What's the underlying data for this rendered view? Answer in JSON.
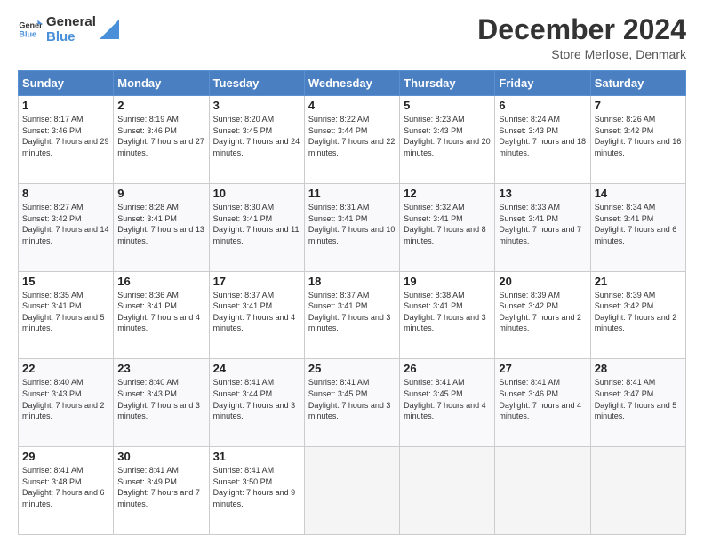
{
  "header": {
    "logo_general": "General",
    "logo_blue": "Blue",
    "month_title": "December 2024",
    "subtitle": "Store Merlose, Denmark"
  },
  "days_of_week": [
    "Sunday",
    "Monday",
    "Tuesday",
    "Wednesday",
    "Thursday",
    "Friday",
    "Saturday"
  ],
  "weeks": [
    [
      {
        "day": "1",
        "sunrise": "8:17 AM",
        "sunset": "3:46 PM",
        "daylight": "7 hours and 29 minutes."
      },
      {
        "day": "2",
        "sunrise": "8:19 AM",
        "sunset": "3:46 PM",
        "daylight": "7 hours and 27 minutes."
      },
      {
        "day": "3",
        "sunrise": "8:20 AM",
        "sunset": "3:45 PM",
        "daylight": "7 hours and 24 minutes."
      },
      {
        "day": "4",
        "sunrise": "8:22 AM",
        "sunset": "3:44 PM",
        "daylight": "7 hours and 22 minutes."
      },
      {
        "day": "5",
        "sunrise": "8:23 AM",
        "sunset": "3:43 PM",
        "daylight": "7 hours and 20 minutes."
      },
      {
        "day": "6",
        "sunrise": "8:24 AM",
        "sunset": "3:43 PM",
        "daylight": "7 hours and 18 minutes."
      },
      {
        "day": "7",
        "sunrise": "8:26 AM",
        "sunset": "3:42 PM",
        "daylight": "7 hours and 16 minutes."
      }
    ],
    [
      {
        "day": "8",
        "sunrise": "8:27 AM",
        "sunset": "3:42 PM",
        "daylight": "7 hours and 14 minutes."
      },
      {
        "day": "9",
        "sunrise": "8:28 AM",
        "sunset": "3:41 PM",
        "daylight": "7 hours and 13 minutes."
      },
      {
        "day": "10",
        "sunrise": "8:30 AM",
        "sunset": "3:41 PM",
        "daylight": "7 hours and 11 minutes."
      },
      {
        "day": "11",
        "sunrise": "8:31 AM",
        "sunset": "3:41 PM",
        "daylight": "7 hours and 10 minutes."
      },
      {
        "day": "12",
        "sunrise": "8:32 AM",
        "sunset": "3:41 PM",
        "daylight": "7 hours and 8 minutes."
      },
      {
        "day": "13",
        "sunrise": "8:33 AM",
        "sunset": "3:41 PM",
        "daylight": "7 hours and 7 minutes."
      },
      {
        "day": "14",
        "sunrise": "8:34 AM",
        "sunset": "3:41 PM",
        "daylight": "7 hours and 6 minutes."
      }
    ],
    [
      {
        "day": "15",
        "sunrise": "8:35 AM",
        "sunset": "3:41 PM",
        "daylight": "7 hours and 5 minutes."
      },
      {
        "day": "16",
        "sunrise": "8:36 AM",
        "sunset": "3:41 PM",
        "daylight": "7 hours and 4 minutes."
      },
      {
        "day": "17",
        "sunrise": "8:37 AM",
        "sunset": "3:41 PM",
        "daylight": "7 hours and 4 minutes."
      },
      {
        "day": "18",
        "sunrise": "8:37 AM",
        "sunset": "3:41 PM",
        "daylight": "7 hours and 3 minutes."
      },
      {
        "day": "19",
        "sunrise": "8:38 AM",
        "sunset": "3:41 PM",
        "daylight": "7 hours and 3 minutes."
      },
      {
        "day": "20",
        "sunrise": "8:39 AM",
        "sunset": "3:42 PM",
        "daylight": "7 hours and 2 minutes."
      },
      {
        "day": "21",
        "sunrise": "8:39 AM",
        "sunset": "3:42 PM",
        "daylight": "7 hours and 2 minutes."
      }
    ],
    [
      {
        "day": "22",
        "sunrise": "8:40 AM",
        "sunset": "3:43 PM",
        "daylight": "7 hours and 2 minutes."
      },
      {
        "day": "23",
        "sunrise": "8:40 AM",
        "sunset": "3:43 PM",
        "daylight": "7 hours and 3 minutes."
      },
      {
        "day": "24",
        "sunrise": "8:41 AM",
        "sunset": "3:44 PM",
        "daylight": "7 hours and 3 minutes."
      },
      {
        "day": "25",
        "sunrise": "8:41 AM",
        "sunset": "3:45 PM",
        "daylight": "7 hours and 3 minutes."
      },
      {
        "day": "26",
        "sunrise": "8:41 AM",
        "sunset": "3:45 PM",
        "daylight": "7 hours and 4 minutes."
      },
      {
        "day": "27",
        "sunrise": "8:41 AM",
        "sunset": "3:46 PM",
        "daylight": "7 hours and 4 minutes."
      },
      {
        "day": "28",
        "sunrise": "8:41 AM",
        "sunset": "3:47 PM",
        "daylight": "7 hours and 5 minutes."
      }
    ],
    [
      {
        "day": "29",
        "sunrise": "8:41 AM",
        "sunset": "3:48 PM",
        "daylight": "7 hours and 6 minutes."
      },
      {
        "day": "30",
        "sunrise": "8:41 AM",
        "sunset": "3:49 PM",
        "daylight": "7 hours and 7 minutes."
      },
      {
        "day": "31",
        "sunrise": "8:41 AM",
        "sunset": "3:50 PM",
        "daylight": "7 hours and 9 minutes."
      },
      null,
      null,
      null,
      null
    ]
  ]
}
